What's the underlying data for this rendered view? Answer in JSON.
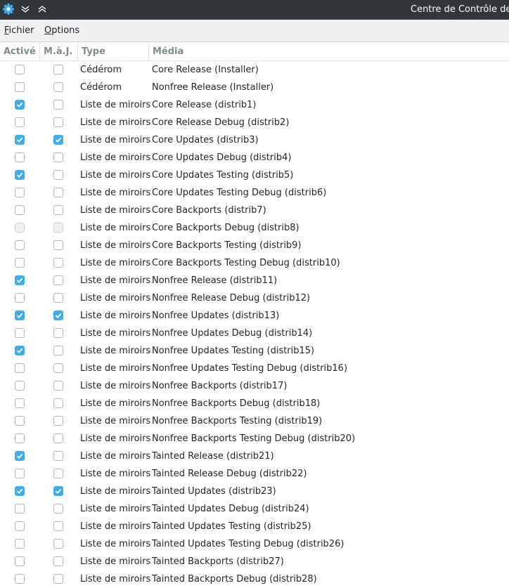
{
  "window": {
    "title": "Centre de Contrôle de M",
    "app_icon": "gear-icon",
    "buttons": [
      "chevron-down-double-icon",
      "chevron-up-double-icon"
    ]
  },
  "menubar": {
    "items": [
      {
        "label": "Fichier",
        "mnemonic": "F"
      },
      {
        "label": "Options",
        "mnemonic": "O"
      }
    ]
  },
  "table": {
    "columns": [
      "Activé",
      "M.à.J.",
      "Type",
      "Média"
    ],
    "rows": [
      {
        "enabled": false,
        "update": false,
        "type": "Cédérom",
        "media": "Core Release (Installer)"
      },
      {
        "enabled": false,
        "update": false,
        "type": "Cédérom",
        "media": "Nonfree Release (Installer)"
      },
      {
        "enabled": true,
        "update": false,
        "type": "Liste de miroirs",
        "media": "Core Release (distrib1)"
      },
      {
        "enabled": false,
        "update": false,
        "type": "Liste de miroirs",
        "media": "Core Release Debug (distrib2)"
      },
      {
        "enabled": true,
        "update": true,
        "type": "Liste de miroirs",
        "media": "Core Updates (distrib3)"
      },
      {
        "enabled": false,
        "update": false,
        "type": "Liste de miroirs",
        "media": "Core Updates Debug (distrib4)"
      },
      {
        "enabled": true,
        "update": false,
        "type": "Liste de miroirs",
        "media": "Core Updates Testing (distrib5)"
      },
      {
        "enabled": false,
        "update": false,
        "type": "Liste de miroirs",
        "media": "Core Updates Testing Debug (distrib6)"
      },
      {
        "enabled": false,
        "update": false,
        "type": "Liste de miroirs",
        "media": "Core Backports (distrib7)"
      },
      {
        "enabled": false,
        "update": false,
        "disabled": true,
        "type": "Liste de miroirs",
        "media": "Core Backports Debug (distrib8)"
      },
      {
        "enabled": false,
        "update": false,
        "type": "Liste de miroirs",
        "media": "Core Backports Testing (distrib9)"
      },
      {
        "enabled": false,
        "update": false,
        "type": "Liste de miroirs",
        "media": "Core Backports Testing Debug (distrib10)"
      },
      {
        "enabled": true,
        "update": false,
        "type": "Liste de miroirs",
        "media": "Nonfree Release (distrib11)"
      },
      {
        "enabled": false,
        "update": false,
        "type": "Liste de miroirs",
        "media": "Nonfree Release Debug (distrib12)"
      },
      {
        "enabled": true,
        "update": true,
        "type": "Liste de miroirs",
        "media": "Nonfree Updates (distrib13)"
      },
      {
        "enabled": false,
        "update": false,
        "type": "Liste de miroirs",
        "media": "Nonfree Updates Debug (distrib14)"
      },
      {
        "enabled": true,
        "update": false,
        "type": "Liste de miroirs",
        "media": "Nonfree Updates Testing (distrib15)"
      },
      {
        "enabled": false,
        "update": false,
        "type": "Liste de miroirs",
        "media": "Nonfree Updates Testing Debug (distrib16)"
      },
      {
        "enabled": false,
        "update": false,
        "type": "Liste de miroirs",
        "media": "Nonfree Backports (distrib17)"
      },
      {
        "enabled": false,
        "update": false,
        "type": "Liste de miroirs",
        "media": "Nonfree Backports Debug (distrib18)"
      },
      {
        "enabled": false,
        "update": false,
        "type": "Liste de miroirs",
        "media": "Nonfree Backports Testing (distrib19)"
      },
      {
        "enabled": false,
        "update": false,
        "type": "Liste de miroirs",
        "media": "Nonfree Backports Testing Debug (distrib20)"
      },
      {
        "enabled": true,
        "update": false,
        "type": "Liste de miroirs",
        "media": "Tainted Release (distrib21)"
      },
      {
        "enabled": false,
        "update": false,
        "type": "Liste de miroirs",
        "media": "Tainted Release Debug (distrib22)"
      },
      {
        "enabled": true,
        "update": true,
        "type": "Liste de miroirs",
        "media": "Tainted Updates (distrib23)"
      },
      {
        "enabled": false,
        "update": false,
        "type": "Liste de miroirs",
        "media": "Tainted Updates Debug (distrib24)"
      },
      {
        "enabled": false,
        "update": false,
        "type": "Liste de miroirs",
        "media": "Tainted Updates Testing (distrib25)"
      },
      {
        "enabled": false,
        "update": false,
        "type": "Liste de miroirs",
        "media": "Tainted Updates Testing Debug (distrib26)"
      },
      {
        "enabled": false,
        "update": false,
        "type": "Liste de miroirs",
        "media": "Tainted Backports (distrib27)"
      },
      {
        "enabled": false,
        "update": false,
        "type": "Liste de miroirs",
        "media": "Tainted Backports Debug (distrib28)"
      }
    ]
  },
  "colors": {
    "titlebar": "#31363b",
    "accent": "#3daee9",
    "header_text": "#7f8c8d"
  }
}
